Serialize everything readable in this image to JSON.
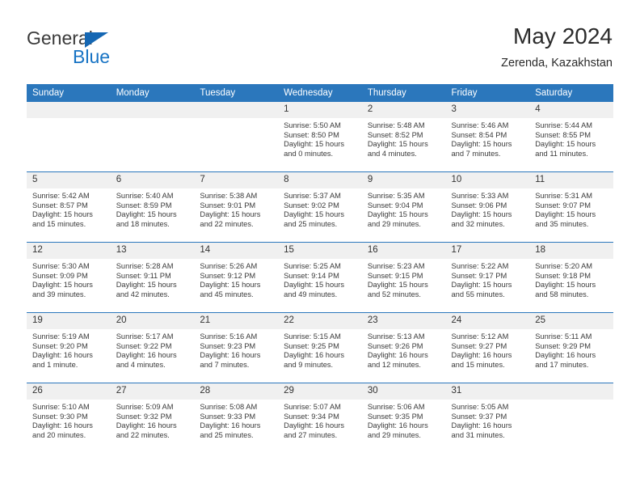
{
  "brand": {
    "name_part1": "General",
    "name_part2": "Blue",
    "accent_color": "#1773c4",
    "triangle_color": "#1567b3"
  },
  "header": {
    "title": "May 2024",
    "location": "Zerenda, Kazakhstan"
  },
  "calendar": {
    "header_bg": "#2b77bc",
    "daynum_bg": "#f0f0f0",
    "weekday_headers": [
      "Sunday",
      "Monday",
      "Tuesday",
      "Wednesday",
      "Thursday",
      "Friday",
      "Saturday"
    ],
    "weeks": [
      [
        {
          "day": "",
          "empty": true
        },
        {
          "day": "",
          "empty": true
        },
        {
          "day": "",
          "empty": true
        },
        {
          "day": "1",
          "sunrise": "Sunrise: 5:50 AM",
          "sunset": "Sunset: 8:50 PM",
          "daylight_line1": "Daylight: 15 hours",
          "daylight_line2": "and 0 minutes."
        },
        {
          "day": "2",
          "sunrise": "Sunrise: 5:48 AM",
          "sunset": "Sunset: 8:52 PM",
          "daylight_line1": "Daylight: 15 hours",
          "daylight_line2": "and 4 minutes."
        },
        {
          "day": "3",
          "sunrise": "Sunrise: 5:46 AM",
          "sunset": "Sunset: 8:54 PM",
          "daylight_line1": "Daylight: 15 hours",
          "daylight_line2": "and 7 minutes."
        },
        {
          "day": "4",
          "sunrise": "Sunrise: 5:44 AM",
          "sunset": "Sunset: 8:55 PM",
          "daylight_line1": "Daylight: 15 hours",
          "daylight_line2": "and 11 minutes."
        }
      ],
      [
        {
          "day": "5",
          "sunrise": "Sunrise: 5:42 AM",
          "sunset": "Sunset: 8:57 PM",
          "daylight_line1": "Daylight: 15 hours",
          "daylight_line2": "and 15 minutes."
        },
        {
          "day": "6",
          "sunrise": "Sunrise: 5:40 AM",
          "sunset": "Sunset: 8:59 PM",
          "daylight_line1": "Daylight: 15 hours",
          "daylight_line2": "and 18 minutes."
        },
        {
          "day": "7",
          "sunrise": "Sunrise: 5:38 AM",
          "sunset": "Sunset: 9:01 PM",
          "daylight_line1": "Daylight: 15 hours",
          "daylight_line2": "and 22 minutes."
        },
        {
          "day": "8",
          "sunrise": "Sunrise: 5:37 AM",
          "sunset": "Sunset: 9:02 PM",
          "daylight_line1": "Daylight: 15 hours",
          "daylight_line2": "and 25 minutes."
        },
        {
          "day": "9",
          "sunrise": "Sunrise: 5:35 AM",
          "sunset": "Sunset: 9:04 PM",
          "daylight_line1": "Daylight: 15 hours",
          "daylight_line2": "and 29 minutes."
        },
        {
          "day": "10",
          "sunrise": "Sunrise: 5:33 AM",
          "sunset": "Sunset: 9:06 PM",
          "daylight_line1": "Daylight: 15 hours",
          "daylight_line2": "and 32 minutes."
        },
        {
          "day": "11",
          "sunrise": "Sunrise: 5:31 AM",
          "sunset": "Sunset: 9:07 PM",
          "daylight_line1": "Daylight: 15 hours",
          "daylight_line2": "and 35 minutes."
        }
      ],
      [
        {
          "day": "12",
          "sunrise": "Sunrise: 5:30 AM",
          "sunset": "Sunset: 9:09 PM",
          "daylight_line1": "Daylight: 15 hours",
          "daylight_line2": "and 39 minutes."
        },
        {
          "day": "13",
          "sunrise": "Sunrise: 5:28 AM",
          "sunset": "Sunset: 9:11 PM",
          "daylight_line1": "Daylight: 15 hours",
          "daylight_line2": "and 42 minutes."
        },
        {
          "day": "14",
          "sunrise": "Sunrise: 5:26 AM",
          "sunset": "Sunset: 9:12 PM",
          "daylight_line1": "Daylight: 15 hours",
          "daylight_line2": "and 45 minutes."
        },
        {
          "day": "15",
          "sunrise": "Sunrise: 5:25 AM",
          "sunset": "Sunset: 9:14 PM",
          "daylight_line1": "Daylight: 15 hours",
          "daylight_line2": "and 49 minutes."
        },
        {
          "day": "16",
          "sunrise": "Sunrise: 5:23 AM",
          "sunset": "Sunset: 9:15 PM",
          "daylight_line1": "Daylight: 15 hours",
          "daylight_line2": "and 52 minutes."
        },
        {
          "day": "17",
          "sunrise": "Sunrise: 5:22 AM",
          "sunset": "Sunset: 9:17 PM",
          "daylight_line1": "Daylight: 15 hours",
          "daylight_line2": "and 55 minutes."
        },
        {
          "day": "18",
          "sunrise": "Sunrise: 5:20 AM",
          "sunset": "Sunset: 9:18 PM",
          "daylight_line1": "Daylight: 15 hours",
          "daylight_line2": "and 58 minutes."
        }
      ],
      [
        {
          "day": "19",
          "sunrise": "Sunrise: 5:19 AM",
          "sunset": "Sunset: 9:20 PM",
          "daylight_line1": "Daylight: 16 hours",
          "daylight_line2": "and 1 minute."
        },
        {
          "day": "20",
          "sunrise": "Sunrise: 5:17 AM",
          "sunset": "Sunset: 9:22 PM",
          "daylight_line1": "Daylight: 16 hours",
          "daylight_line2": "and 4 minutes."
        },
        {
          "day": "21",
          "sunrise": "Sunrise: 5:16 AM",
          "sunset": "Sunset: 9:23 PM",
          "daylight_line1": "Daylight: 16 hours",
          "daylight_line2": "and 7 minutes."
        },
        {
          "day": "22",
          "sunrise": "Sunrise: 5:15 AM",
          "sunset": "Sunset: 9:25 PM",
          "daylight_line1": "Daylight: 16 hours",
          "daylight_line2": "and 9 minutes."
        },
        {
          "day": "23",
          "sunrise": "Sunrise: 5:13 AM",
          "sunset": "Sunset: 9:26 PM",
          "daylight_line1": "Daylight: 16 hours",
          "daylight_line2": "and 12 minutes."
        },
        {
          "day": "24",
          "sunrise": "Sunrise: 5:12 AM",
          "sunset": "Sunset: 9:27 PM",
          "daylight_line1": "Daylight: 16 hours",
          "daylight_line2": "and 15 minutes."
        },
        {
          "day": "25",
          "sunrise": "Sunrise: 5:11 AM",
          "sunset": "Sunset: 9:29 PM",
          "daylight_line1": "Daylight: 16 hours",
          "daylight_line2": "and 17 minutes."
        }
      ],
      [
        {
          "day": "26",
          "sunrise": "Sunrise: 5:10 AM",
          "sunset": "Sunset: 9:30 PM",
          "daylight_line1": "Daylight: 16 hours",
          "daylight_line2": "and 20 minutes."
        },
        {
          "day": "27",
          "sunrise": "Sunrise: 5:09 AM",
          "sunset": "Sunset: 9:32 PM",
          "daylight_line1": "Daylight: 16 hours",
          "daylight_line2": "and 22 minutes."
        },
        {
          "day": "28",
          "sunrise": "Sunrise: 5:08 AM",
          "sunset": "Sunset: 9:33 PM",
          "daylight_line1": "Daylight: 16 hours",
          "daylight_line2": "and 25 minutes."
        },
        {
          "day": "29",
          "sunrise": "Sunrise: 5:07 AM",
          "sunset": "Sunset: 9:34 PM",
          "daylight_line1": "Daylight: 16 hours",
          "daylight_line2": "and 27 minutes."
        },
        {
          "day": "30",
          "sunrise": "Sunrise: 5:06 AM",
          "sunset": "Sunset: 9:35 PM",
          "daylight_line1": "Daylight: 16 hours",
          "daylight_line2": "and 29 minutes."
        },
        {
          "day": "31",
          "sunrise": "Sunrise: 5:05 AM",
          "sunset": "Sunset: 9:37 PM",
          "daylight_line1": "Daylight: 16 hours",
          "daylight_line2": "and 31 minutes."
        },
        {
          "day": "",
          "empty": true
        }
      ]
    ]
  }
}
